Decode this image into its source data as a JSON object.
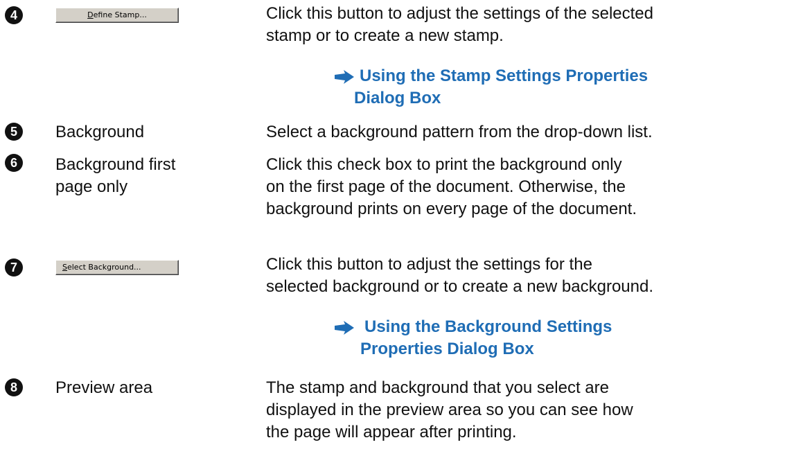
{
  "rows": [
    {
      "number": "4",
      "button_label_rest": "efine Stamp...",
      "button_label_mnemonic": "D",
      "desc": [
        "Click this button to adjust the settings of the selected",
        "stamp or to create a new stamp."
      ],
      "link": [
        "Using the Stamp Settings Properties",
        "Dialog Box"
      ]
    },
    {
      "number": "5",
      "label": "Background",
      "desc": [
        "Select a background pattern from the drop-down list."
      ]
    },
    {
      "number": "6",
      "label": [
        "Background first",
        "page only"
      ],
      "desc": [
        "Click this check box to print the background only",
        "on the first page of the document. Otherwise, the",
        "background prints on every page of the document."
      ]
    },
    {
      "number": "7",
      "button_label_mnemonic": "S",
      "button_label_rest": "elect Background...",
      "desc": [
        "Click this button to adjust the settings for the",
        "selected background or to create a new background."
      ],
      "link": [
        "Using the Background Settings",
        "Properties Dialog Box"
      ]
    },
    {
      "number": "8",
      "label": "Preview area",
      "desc": [
        "The stamp and background that you select are",
        "displayed in the preview area so you can see how",
        "the page will appear after printing."
      ]
    }
  ],
  "colors": {
    "link": "#1f6db5",
    "badge": "#111111",
    "button_face": "#d4d0c8"
  },
  "icons": {
    "link_arrow": "blue-right-arrow-icon",
    "row_number": "black-circle-number-badge"
  }
}
